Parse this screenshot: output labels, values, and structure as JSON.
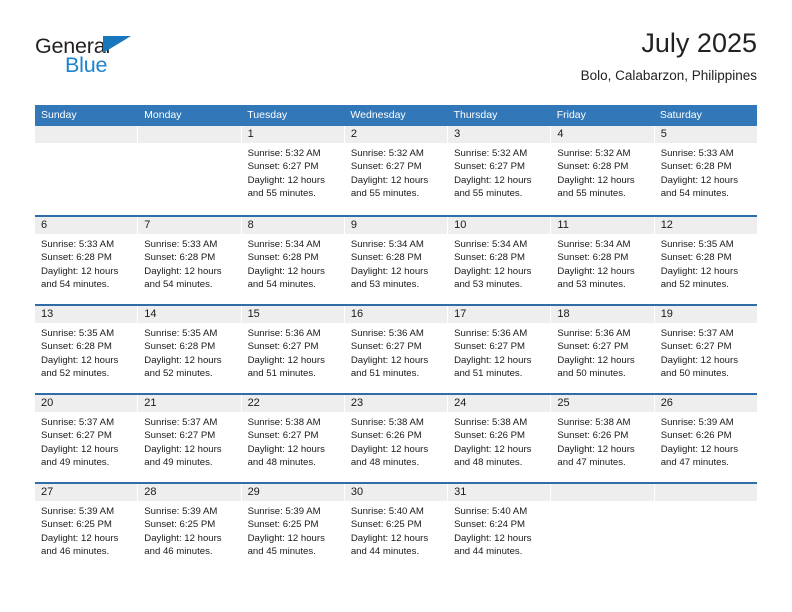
{
  "brand": {
    "name_top": "General",
    "name_bottom": "Blue",
    "triangle_color": "#1877bd",
    "blue_text_color": "#1b84d1"
  },
  "header": {
    "title": "July 2025",
    "subtitle": "Bolo, Calabarzon, Philippines"
  },
  "theme": {
    "header_blue": "#3277b8",
    "row_divider_blue": "#2e6da8",
    "daynum_band_gray": "#eeeeee"
  },
  "weekdays": [
    "Sunday",
    "Monday",
    "Tuesday",
    "Wednesday",
    "Thursday",
    "Friday",
    "Saturday"
  ],
  "weeks": [
    [
      {
        "day": "",
        "sunrise": "",
        "sunset": "",
        "daylight1": "",
        "daylight2": ""
      },
      {
        "day": "",
        "sunrise": "",
        "sunset": "",
        "daylight1": "",
        "daylight2": ""
      },
      {
        "day": "1",
        "sunrise": "Sunrise: 5:32 AM",
        "sunset": "Sunset: 6:27 PM",
        "daylight1": "Daylight: 12 hours",
        "daylight2": "and 55 minutes."
      },
      {
        "day": "2",
        "sunrise": "Sunrise: 5:32 AM",
        "sunset": "Sunset: 6:27 PM",
        "daylight1": "Daylight: 12 hours",
        "daylight2": "and 55 minutes."
      },
      {
        "day": "3",
        "sunrise": "Sunrise: 5:32 AM",
        "sunset": "Sunset: 6:27 PM",
        "daylight1": "Daylight: 12 hours",
        "daylight2": "and 55 minutes."
      },
      {
        "day": "4",
        "sunrise": "Sunrise: 5:32 AM",
        "sunset": "Sunset: 6:28 PM",
        "daylight1": "Daylight: 12 hours",
        "daylight2": "and 55 minutes."
      },
      {
        "day": "5",
        "sunrise": "Sunrise: 5:33 AM",
        "sunset": "Sunset: 6:28 PM",
        "daylight1": "Daylight: 12 hours",
        "daylight2": "and 54 minutes."
      }
    ],
    [
      {
        "day": "6",
        "sunrise": "Sunrise: 5:33 AM",
        "sunset": "Sunset: 6:28 PM",
        "daylight1": "Daylight: 12 hours",
        "daylight2": "and 54 minutes."
      },
      {
        "day": "7",
        "sunrise": "Sunrise: 5:33 AM",
        "sunset": "Sunset: 6:28 PM",
        "daylight1": "Daylight: 12 hours",
        "daylight2": "and 54 minutes."
      },
      {
        "day": "8",
        "sunrise": "Sunrise: 5:34 AM",
        "sunset": "Sunset: 6:28 PM",
        "daylight1": "Daylight: 12 hours",
        "daylight2": "and 54 minutes."
      },
      {
        "day": "9",
        "sunrise": "Sunrise: 5:34 AM",
        "sunset": "Sunset: 6:28 PM",
        "daylight1": "Daylight: 12 hours",
        "daylight2": "and 53 minutes."
      },
      {
        "day": "10",
        "sunrise": "Sunrise: 5:34 AM",
        "sunset": "Sunset: 6:28 PM",
        "daylight1": "Daylight: 12 hours",
        "daylight2": "and 53 minutes."
      },
      {
        "day": "11",
        "sunrise": "Sunrise: 5:34 AM",
        "sunset": "Sunset: 6:28 PM",
        "daylight1": "Daylight: 12 hours",
        "daylight2": "and 53 minutes."
      },
      {
        "day": "12",
        "sunrise": "Sunrise: 5:35 AM",
        "sunset": "Sunset: 6:28 PM",
        "daylight1": "Daylight: 12 hours",
        "daylight2": "and 52 minutes."
      }
    ],
    [
      {
        "day": "13",
        "sunrise": "Sunrise: 5:35 AM",
        "sunset": "Sunset: 6:28 PM",
        "daylight1": "Daylight: 12 hours",
        "daylight2": "and 52 minutes."
      },
      {
        "day": "14",
        "sunrise": "Sunrise: 5:35 AM",
        "sunset": "Sunset: 6:28 PM",
        "daylight1": "Daylight: 12 hours",
        "daylight2": "and 52 minutes."
      },
      {
        "day": "15",
        "sunrise": "Sunrise: 5:36 AM",
        "sunset": "Sunset: 6:27 PM",
        "daylight1": "Daylight: 12 hours",
        "daylight2": "and 51 minutes."
      },
      {
        "day": "16",
        "sunrise": "Sunrise: 5:36 AM",
        "sunset": "Sunset: 6:27 PM",
        "daylight1": "Daylight: 12 hours",
        "daylight2": "and 51 minutes."
      },
      {
        "day": "17",
        "sunrise": "Sunrise: 5:36 AM",
        "sunset": "Sunset: 6:27 PM",
        "daylight1": "Daylight: 12 hours",
        "daylight2": "and 51 minutes."
      },
      {
        "day": "18",
        "sunrise": "Sunrise: 5:36 AM",
        "sunset": "Sunset: 6:27 PM",
        "daylight1": "Daylight: 12 hours",
        "daylight2": "and 50 minutes."
      },
      {
        "day": "19",
        "sunrise": "Sunrise: 5:37 AM",
        "sunset": "Sunset: 6:27 PM",
        "daylight1": "Daylight: 12 hours",
        "daylight2": "and 50 minutes."
      }
    ],
    [
      {
        "day": "20",
        "sunrise": "Sunrise: 5:37 AM",
        "sunset": "Sunset: 6:27 PM",
        "daylight1": "Daylight: 12 hours",
        "daylight2": "and 49 minutes."
      },
      {
        "day": "21",
        "sunrise": "Sunrise: 5:37 AM",
        "sunset": "Sunset: 6:27 PM",
        "daylight1": "Daylight: 12 hours",
        "daylight2": "and 49 minutes."
      },
      {
        "day": "22",
        "sunrise": "Sunrise: 5:38 AM",
        "sunset": "Sunset: 6:27 PM",
        "daylight1": "Daylight: 12 hours",
        "daylight2": "and 48 minutes."
      },
      {
        "day": "23",
        "sunrise": "Sunrise: 5:38 AM",
        "sunset": "Sunset: 6:26 PM",
        "daylight1": "Daylight: 12 hours",
        "daylight2": "and 48 minutes."
      },
      {
        "day": "24",
        "sunrise": "Sunrise: 5:38 AM",
        "sunset": "Sunset: 6:26 PM",
        "daylight1": "Daylight: 12 hours",
        "daylight2": "and 48 minutes."
      },
      {
        "day": "25",
        "sunrise": "Sunrise: 5:38 AM",
        "sunset": "Sunset: 6:26 PM",
        "daylight1": "Daylight: 12 hours",
        "daylight2": "and 47 minutes."
      },
      {
        "day": "26",
        "sunrise": "Sunrise: 5:39 AM",
        "sunset": "Sunset: 6:26 PM",
        "daylight1": "Daylight: 12 hours",
        "daylight2": "and 47 minutes."
      }
    ],
    [
      {
        "day": "27",
        "sunrise": "Sunrise: 5:39 AM",
        "sunset": "Sunset: 6:25 PM",
        "daylight1": "Daylight: 12 hours",
        "daylight2": "and 46 minutes."
      },
      {
        "day": "28",
        "sunrise": "Sunrise: 5:39 AM",
        "sunset": "Sunset: 6:25 PM",
        "daylight1": "Daylight: 12 hours",
        "daylight2": "and 46 minutes."
      },
      {
        "day": "29",
        "sunrise": "Sunrise: 5:39 AM",
        "sunset": "Sunset: 6:25 PM",
        "daylight1": "Daylight: 12 hours",
        "daylight2": "and 45 minutes."
      },
      {
        "day": "30",
        "sunrise": "Sunrise: 5:40 AM",
        "sunset": "Sunset: 6:25 PM",
        "daylight1": "Daylight: 12 hours",
        "daylight2": "and 44 minutes."
      },
      {
        "day": "31",
        "sunrise": "Sunrise: 5:40 AM",
        "sunset": "Sunset: 6:24 PM",
        "daylight1": "Daylight: 12 hours",
        "daylight2": "and 44 minutes."
      },
      {
        "day": "",
        "sunrise": "",
        "sunset": "",
        "daylight1": "",
        "daylight2": ""
      },
      {
        "day": "",
        "sunrise": "",
        "sunset": "",
        "daylight1": "",
        "daylight2": ""
      }
    ]
  ]
}
